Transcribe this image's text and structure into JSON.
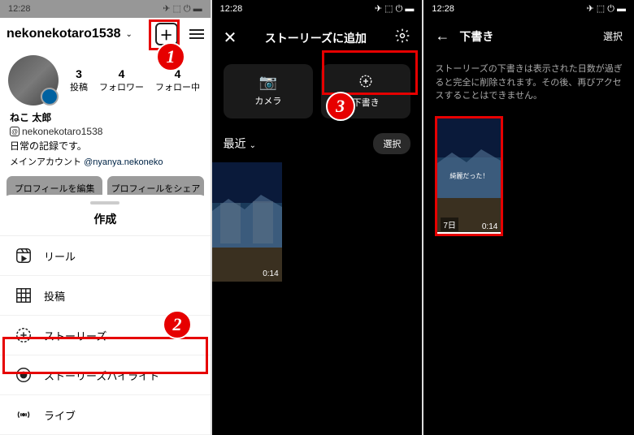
{
  "status": {
    "time": "12:28",
    "icons": "⬇ ● ⋈",
    "right": "✈ ⬚ ⏻ ▬"
  },
  "profile": {
    "username": "nekonekotaro1538",
    "stats": [
      {
        "num": "3",
        "label": "投稿"
      },
      {
        "num": "4",
        "label": "フォロワー"
      },
      {
        "num": "4",
        "label": "フォロー中"
      }
    ],
    "displayName": "ねこ 太郎",
    "threads": "nekonekotaro1538",
    "bio": "日常の記録です。",
    "linkLabel": "メインアカウント",
    "linkHandle": "@nyanya.nekoneko",
    "editBtn": "プロフィールを編集",
    "shareBtn": "プロフィールをシェア"
  },
  "sheet": {
    "title": "作成",
    "items": [
      {
        "label": "リール"
      },
      {
        "label": "投稿"
      },
      {
        "label": "ストーリーズ"
      },
      {
        "label": "ストーリーズハイライト"
      },
      {
        "label": "ライブ"
      }
    ]
  },
  "story": {
    "title": "ストーリーズに追加",
    "tabCamera": "カメラ",
    "tabDraft": "下書き",
    "recent": "最近",
    "select": "選択",
    "duration": "0:14"
  },
  "drafts": {
    "title": "下書き",
    "select": "選択",
    "message": "ストーリーズの下書きは表示された日数が過ぎると完全に削除されます。その後、再びアクセスすることはできません。",
    "overlay": "綺麗だった！",
    "days": "7日",
    "duration": "0:14"
  },
  "callouts": {
    "c1": "1",
    "c2": "2",
    "c3": "3"
  }
}
